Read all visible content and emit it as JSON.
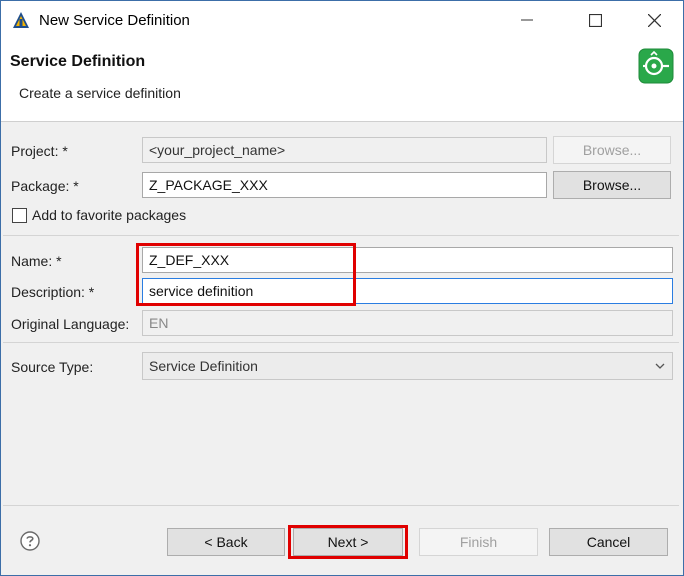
{
  "window": {
    "title": "New Service Definition",
    "icon": "eclipse-adt-icon"
  },
  "header": {
    "title": "Service Definition",
    "subtitle": "Create a service definition",
    "banner_icon": "service-definition-icon",
    "accent": "#2aa84a"
  },
  "form": {
    "project": {
      "label": "Project: *",
      "value": "<your_project_name>",
      "browse_label": "Browse..."
    },
    "package": {
      "label": "Package: *",
      "value": "Z_PACKAGE_XXX",
      "browse_label": "Browse..."
    },
    "favorite": {
      "label": "Add to favorite packages",
      "checked": false
    },
    "name": {
      "label": "Name: *",
      "value": "Z_DEF_XXX"
    },
    "description": {
      "label": "Description: *",
      "value": "service definition"
    },
    "original_language": {
      "label": "Original Language:",
      "value": "EN"
    },
    "source_type": {
      "label": "Source Type:",
      "value": "Service Definition"
    }
  },
  "buttons": {
    "back": "< Back",
    "next": "Next >",
    "finish": "Finish",
    "cancel": "Cancel"
  },
  "highlight_color": "#e00000"
}
